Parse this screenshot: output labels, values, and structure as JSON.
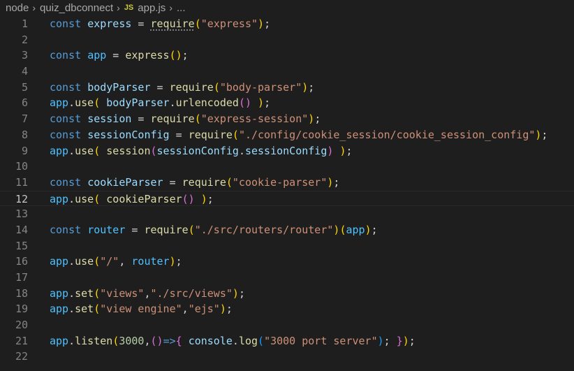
{
  "breadcrumb": {
    "items": [
      "node",
      "quiz_dbconnect"
    ],
    "file_badge": "JS",
    "file": "app.js",
    "more": "..."
  },
  "editor": {
    "current_line": 12,
    "lines": [
      {
        "n": "1",
        "tokens": [
          [
            "const",
            "kw"
          ],
          [
            " ",
            "p"
          ],
          [
            "express",
            "id"
          ],
          [
            " = ",
            "p"
          ],
          [
            "require",
            "fn"
          ],
          [
            "(",
            "b1"
          ],
          [
            "\"express\"",
            "str"
          ],
          [
            ")",
            "b1"
          ],
          [
            ";",
            "p"
          ]
        ]
      },
      {
        "n": "2",
        "tokens": []
      },
      {
        "n": "3",
        "tokens": [
          [
            "const",
            "kw"
          ],
          [
            " ",
            "p"
          ],
          [
            "app",
            "var"
          ],
          [
            " = ",
            "p"
          ],
          [
            "express",
            "fn"
          ],
          [
            "()",
            "b1"
          ],
          [
            ";",
            "p"
          ]
        ]
      },
      {
        "n": "4",
        "tokens": []
      },
      {
        "n": "5",
        "tokens": [
          [
            "const",
            "kw"
          ],
          [
            " ",
            "p"
          ],
          [
            "bodyParser",
            "id"
          ],
          [
            " = ",
            "p"
          ],
          [
            "require",
            "fn"
          ],
          [
            "(",
            "b1"
          ],
          [
            "\"body-parser\"",
            "str"
          ],
          [
            ")",
            "b1"
          ],
          [
            ";",
            "p"
          ]
        ]
      },
      {
        "n": "6",
        "tokens": [
          [
            "app",
            "var"
          ],
          [
            ".",
            "p"
          ],
          [
            "use",
            "fn"
          ],
          [
            "(",
            "b1"
          ],
          [
            " ",
            "p"
          ],
          [
            "bodyParser",
            "id"
          ],
          [
            ".",
            "p"
          ],
          [
            "urlencoded",
            "fn"
          ],
          [
            "()",
            "b2"
          ],
          [
            " ",
            "p"
          ],
          [
            ")",
            "b1"
          ],
          [
            ";",
            "p"
          ]
        ]
      },
      {
        "n": "7",
        "tokens": [
          [
            "const",
            "kw"
          ],
          [
            " ",
            "p"
          ],
          [
            "session",
            "id"
          ],
          [
            " = ",
            "p"
          ],
          [
            "require",
            "fn"
          ],
          [
            "(",
            "b1"
          ],
          [
            "\"express-session\"",
            "str"
          ],
          [
            ")",
            "b1"
          ],
          [
            ";",
            "p"
          ]
        ]
      },
      {
        "n": "8",
        "tokens": [
          [
            "const",
            "kw"
          ],
          [
            " ",
            "p"
          ],
          [
            "sessionConfig",
            "id"
          ],
          [
            " = ",
            "p"
          ],
          [
            "require",
            "fn"
          ],
          [
            "(",
            "b1"
          ],
          [
            "\"./config/cookie_session/cookie_session_config\"",
            "str"
          ],
          [
            ")",
            "b1"
          ],
          [
            ";",
            "p"
          ]
        ]
      },
      {
        "n": "9",
        "tokens": [
          [
            "app",
            "var"
          ],
          [
            ".",
            "p"
          ],
          [
            "use",
            "fn"
          ],
          [
            "(",
            "b1"
          ],
          [
            " ",
            "p"
          ],
          [
            "session",
            "fn"
          ],
          [
            "(",
            "b2"
          ],
          [
            "sessionConfig",
            "id"
          ],
          [
            ".",
            "p"
          ],
          [
            "sessionConfig",
            "id"
          ],
          [
            ")",
            "b2"
          ],
          [
            " ",
            "p"
          ],
          [
            ")",
            "b1"
          ],
          [
            ";",
            "p"
          ]
        ]
      },
      {
        "n": "10",
        "tokens": []
      },
      {
        "n": "11",
        "tokens": [
          [
            "const",
            "kw"
          ],
          [
            " ",
            "p"
          ],
          [
            "cookieParser",
            "id"
          ],
          [
            " = ",
            "p"
          ],
          [
            "require",
            "fn"
          ],
          [
            "(",
            "b1"
          ],
          [
            "\"cookie-parser\"",
            "str"
          ],
          [
            ")",
            "b1"
          ],
          [
            ";",
            "p"
          ]
        ]
      },
      {
        "n": "12",
        "tokens": [
          [
            "app",
            "var"
          ],
          [
            ".",
            "p"
          ],
          [
            "use",
            "fn"
          ],
          [
            "(",
            "b1"
          ],
          [
            " ",
            "p"
          ],
          [
            "cookieParser",
            "fn"
          ],
          [
            "()",
            "b2"
          ],
          [
            " ",
            "p"
          ],
          [
            ")",
            "b1"
          ],
          [
            ";",
            "p"
          ]
        ]
      },
      {
        "n": "13",
        "tokens": []
      },
      {
        "n": "14",
        "tokens": [
          [
            "const",
            "kw"
          ],
          [
            " ",
            "p"
          ],
          [
            "router",
            "var"
          ],
          [
            " = ",
            "p"
          ],
          [
            "require",
            "fn"
          ],
          [
            "(",
            "b1"
          ],
          [
            "\"./src/routers/router\"",
            "str"
          ],
          [
            ")",
            "b1"
          ],
          [
            "(",
            "b1"
          ],
          [
            "app",
            "var"
          ],
          [
            ")",
            "b1"
          ],
          [
            ";",
            "p"
          ]
        ]
      },
      {
        "n": "15",
        "tokens": []
      },
      {
        "n": "16",
        "tokens": [
          [
            "app",
            "var"
          ],
          [
            ".",
            "p"
          ],
          [
            "use",
            "fn"
          ],
          [
            "(",
            "b1"
          ],
          [
            "\"/\"",
            "str"
          ],
          [
            ", ",
            "p"
          ],
          [
            "router",
            "var"
          ],
          [
            ")",
            "b1"
          ],
          [
            ";",
            "p"
          ]
        ]
      },
      {
        "n": "17",
        "tokens": []
      },
      {
        "n": "18",
        "tokens": [
          [
            "app",
            "var"
          ],
          [
            ".",
            "p"
          ],
          [
            "set",
            "fn"
          ],
          [
            "(",
            "b1"
          ],
          [
            "\"views\"",
            "str"
          ],
          [
            ",",
            "p"
          ],
          [
            "\"./src/views\"",
            "str"
          ],
          [
            ")",
            "b1"
          ],
          [
            ";",
            "p"
          ]
        ]
      },
      {
        "n": "19",
        "tokens": [
          [
            "app",
            "var"
          ],
          [
            ".",
            "p"
          ],
          [
            "set",
            "fn"
          ],
          [
            "(",
            "b1"
          ],
          [
            "\"view engine\"",
            "str"
          ],
          [
            ",",
            "p"
          ],
          [
            "\"ejs\"",
            "str"
          ],
          [
            ")",
            "b1"
          ],
          [
            ";",
            "p"
          ]
        ]
      },
      {
        "n": "20",
        "tokens": []
      },
      {
        "n": "21",
        "tokens": [
          [
            "app",
            "var"
          ],
          [
            ".",
            "p"
          ],
          [
            "listen",
            "fn"
          ],
          [
            "(",
            "b1"
          ],
          [
            "3000",
            "num"
          ],
          [
            ",",
            "p"
          ],
          [
            "()",
            "b2"
          ],
          [
            "=>",
            "kw"
          ],
          [
            "{",
            "b2"
          ],
          [
            " ",
            "p"
          ],
          [
            "console",
            "id"
          ],
          [
            ".",
            "p"
          ],
          [
            "log",
            "fn"
          ],
          [
            "(",
            "b3"
          ],
          [
            "\"3000 port server\"",
            "str"
          ],
          [
            ")",
            "b3"
          ],
          [
            ";",
            "p"
          ],
          [
            " ",
            "p"
          ],
          [
            "}",
            "b2"
          ],
          [
            ")",
            "b1"
          ],
          [
            ";",
            "p"
          ]
        ]
      },
      {
        "n": "22",
        "tokens": []
      }
    ]
  },
  "colors": {
    "background": "#1e1e1e",
    "keyword": "#569cd6",
    "constant": "#4fc1ff",
    "identifier": "#9cdcfe",
    "function": "#dcdcaa",
    "string": "#ce9178",
    "number": "#b5cea8",
    "bracket_1": "#ffd700",
    "bracket_2": "#da70d6",
    "bracket_3": "#179fff"
  }
}
